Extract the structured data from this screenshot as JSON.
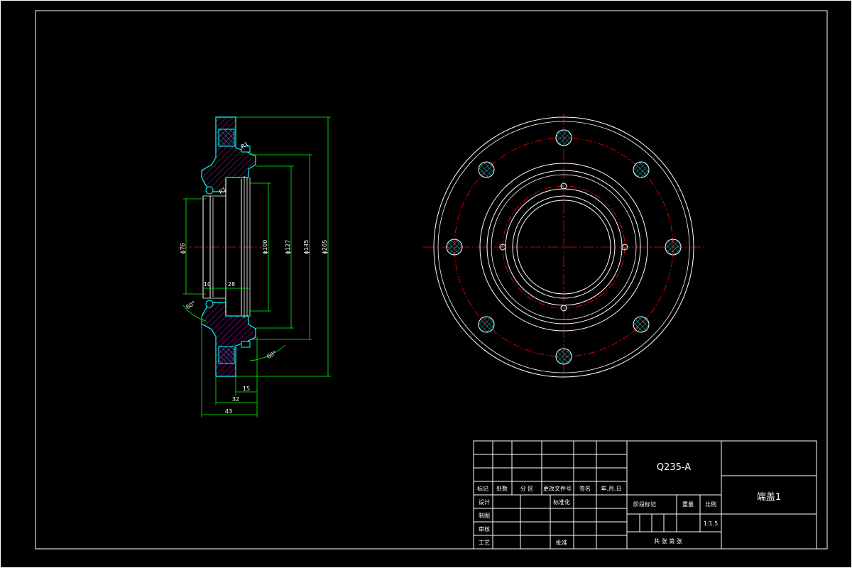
{
  "drawing": {
    "material": "Q235-A",
    "part_name": "端盖1",
    "scale": "1:1.5"
  },
  "dimensions": {
    "dia_76": "ϕ76",
    "dia_100": "ϕ100",
    "dia_127": "ϕ127",
    "dia_145": "ϕ145",
    "dia_205": "ϕ205",
    "len_10": "10",
    "len_28": "28",
    "len_15": "15",
    "len_32": "32",
    "len_43": "43",
    "angle_a": "60°",
    "angle_b": "60°",
    "radius_a": "R1",
    "radius_b": "R1"
  },
  "title_block": {
    "mark": "标记",
    "count": "处数",
    "zone": "分 区",
    "change_doc": "更改文件号",
    "signature": "签名",
    "date": "年.月.日",
    "design": "设计",
    "standardize": "标准化",
    "drafting": "制图",
    "review": "审核",
    "process": "工艺",
    "approve": "批准",
    "stage_mark": "阶段标记",
    "weight": "重量",
    "scale_label": "比例",
    "sheets": "共   张   第   张"
  },
  "colors": {
    "background": "#000000",
    "outline": "#ffffff",
    "section": "#00ffff",
    "hatch": "#ff00ff",
    "centerline": "#ff0000",
    "dimension": "#00ff00"
  }
}
